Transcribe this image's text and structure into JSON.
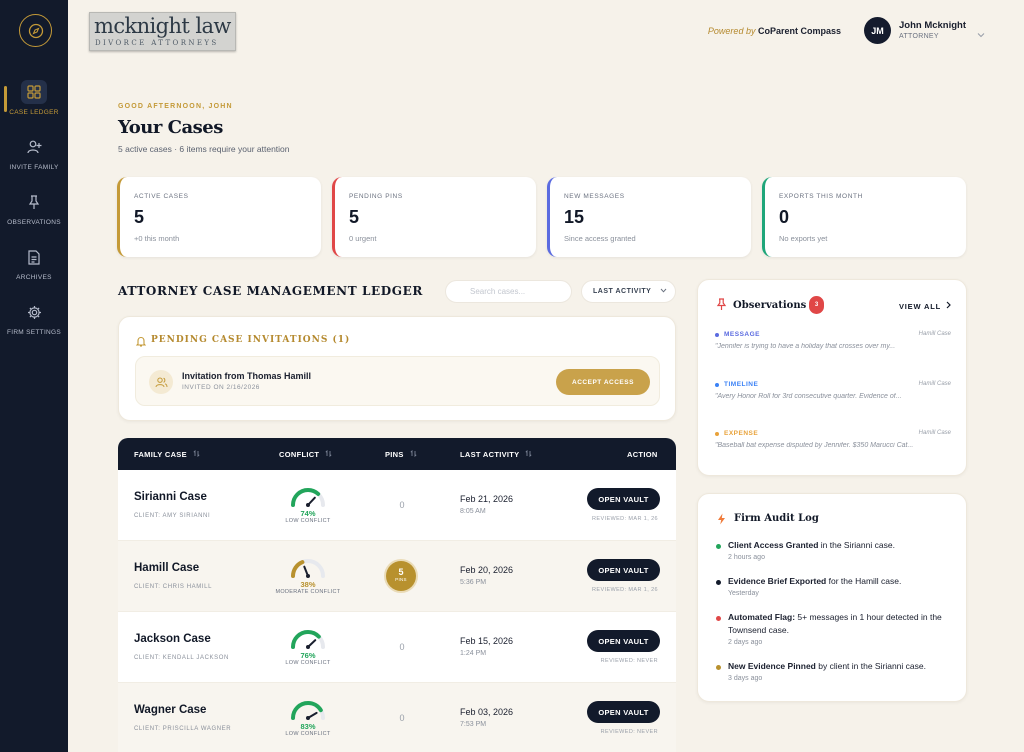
{
  "sidebar": {
    "items": [
      {
        "label": "CASE LEDGER",
        "icon": "grid-icon"
      },
      {
        "label": "INVITE FAMILY",
        "icon": "user-plus-icon"
      },
      {
        "label": "OBSERVATIONS",
        "icon": "pin-icon"
      },
      {
        "label": "ARCHIVES",
        "icon": "document-icon"
      },
      {
        "label": "FIRM SETTINGS",
        "icon": "gear-icon"
      }
    ]
  },
  "brand": {
    "name": "mcknight law",
    "sub": "DIVORCE ATTORNEYS"
  },
  "header": {
    "powered_prefix": "Powered by",
    "powered_brand": "CoParent Compass",
    "user_initials": "JM",
    "user_name": "John Mcknight",
    "user_role": "ATTORNEY"
  },
  "page": {
    "greeting": "GOOD AFTERNOON, JOHN",
    "title": "Your Cases",
    "subtitle": "5 active cases · 6 items require your attention"
  },
  "stats": [
    {
      "label": "ACTIVE CASES",
      "value": "5",
      "sub": "+0 this month",
      "color": "#c49a38"
    },
    {
      "label": "PENDING PINS",
      "value": "5",
      "sub": "0 urgent",
      "color": "#e04747"
    },
    {
      "label": "NEW MESSAGES",
      "value": "15",
      "sub": "Since access granted",
      "color": "#5b6be0"
    },
    {
      "label": "EXPORTS THIS MONTH",
      "value": "0",
      "sub": "No exports yet",
      "color": "#1fa67a"
    }
  ],
  "ledger": {
    "title": "ATTORNEY CASE MANAGEMENT LEDGER",
    "search_placeholder": "Search cases...",
    "sort_label": "LAST ACTIVITY"
  },
  "invitations": {
    "title": "PENDING CASE INVITATIONS (1)",
    "items": [
      {
        "name": "Invitation from Thomas Hamill",
        "date": "INVITED ON 2/16/2026",
        "action": "ACCEPT ACCESS"
      }
    ]
  },
  "table": {
    "columns": [
      "FAMILY CASE",
      "CONFLICT",
      "PINS",
      "LAST ACTIVITY",
      "ACTION"
    ],
    "rows": [
      {
        "case": "Sirianni Case",
        "client": "CLIENT: AMY SIRIANNI",
        "conflict_pct": 74,
        "conflict_text": "74%",
        "conflict_label": "LOW CONFLICT",
        "conflict_color": "#22a55b",
        "pins": "0",
        "pins_unit": "PINS",
        "date": "Feb 21, 2026",
        "time": "8:05 AM",
        "action": "OPEN VAULT",
        "reviewed": "REVIEWED: MAR 1, 26"
      },
      {
        "case": "Hamill Case",
        "client": "CLIENT: CHRIS HAMILL",
        "conflict_pct": 38,
        "conflict_text": "38%",
        "conflict_label": "MODERATE CONFLICT",
        "conflict_color": "#b8912e",
        "pins": "5",
        "pins_unit": "PINS",
        "date": "Feb 20, 2026",
        "time": "5:36 PM",
        "action": "OPEN VAULT",
        "reviewed": "REVIEWED: MAR 1, 26"
      },
      {
        "case": "Jackson Case",
        "client": "CLIENT: KENDALL JACKSON",
        "conflict_pct": 76,
        "conflict_text": "76%",
        "conflict_label": "LOW CONFLICT",
        "conflict_color": "#22a55b",
        "pins": "0",
        "pins_unit": "PINS",
        "date": "Feb 15, 2026",
        "time": "1:24 PM",
        "action": "OPEN VAULT",
        "reviewed": "REVIEWED: NEVER"
      },
      {
        "case": "Wagner Case",
        "client": "CLIENT: PRISCILLA WAGNER",
        "conflict_pct": 83,
        "conflict_text": "83%",
        "conflict_label": "LOW CONFLICT",
        "conflict_color": "#22a55b",
        "pins": "0",
        "pins_unit": "PINS",
        "date": "Feb 03, 2026",
        "time": "7:53 PM",
        "action": "OPEN VAULT",
        "reviewed": "REVIEWED: NEVER"
      }
    ]
  },
  "observations": {
    "title": "Observations",
    "count": "3",
    "view_all": "VIEW ALL",
    "items": [
      {
        "type": "MESSAGE",
        "color": "#5b6be0",
        "case": "Hamill Case",
        "text": "\"Jennifer is trying to have a holiday that crosses over my..."
      },
      {
        "type": "TIMELINE",
        "color": "#3b82f6",
        "case": "Hamill Case",
        "text": "\"Avery Honor Roll for 3rd consecutive quarter. Evidence of..."
      },
      {
        "type": "EXPENSE",
        "color": "#e8a23a",
        "case": "Hamill Case",
        "text": "\"Baseball bat expense disputed by Jennifer. $350 Marucci Cat..."
      }
    ]
  },
  "audit": {
    "title": "Firm Audit Log",
    "items": [
      {
        "bold": "Client Access Granted",
        "rest": " in the Sirianni case.",
        "time": "2 hours ago",
        "color": "#22a55b"
      },
      {
        "bold": "Evidence Brief Exported",
        "rest": " for the Hamill case.",
        "time": "Yesterday",
        "color": "#121a2b"
      },
      {
        "bold": "Automated Flag:",
        "rest": " 5+ messages in 1 hour detected in the Townsend case.",
        "time": "2 days ago",
        "color": "#e04747"
      },
      {
        "bold": "New Evidence Pinned",
        "rest": " by client in the Sirianni case.",
        "time": "3 days ago",
        "color": "#b8912e"
      }
    ]
  }
}
